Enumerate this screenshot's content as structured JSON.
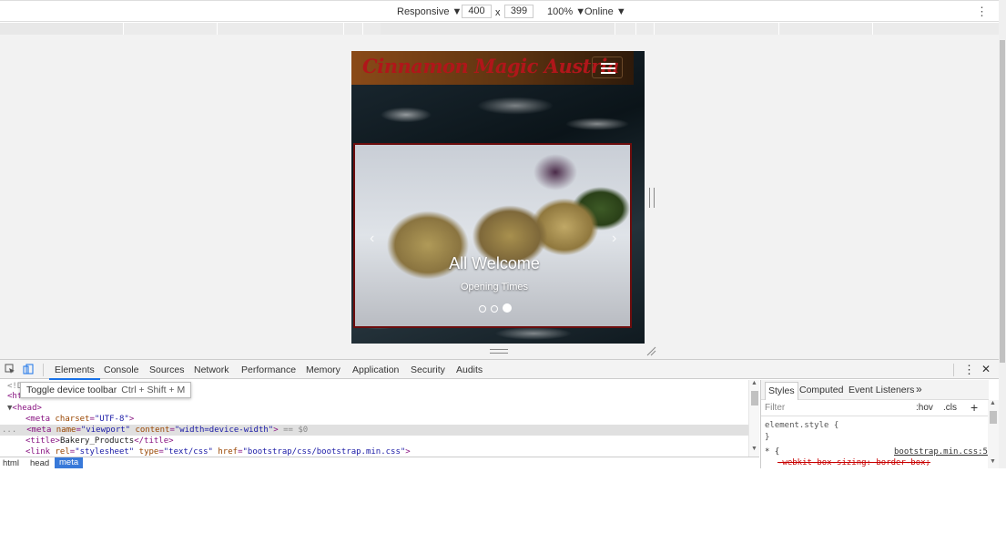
{
  "device_toolbar": {
    "responsive_label": "Responsive ▼",
    "width": "400",
    "times": "x",
    "height": "399",
    "zoom": "100% ▼",
    "network": "Online ▼",
    "more_icon": "kebab-vertical-icon"
  },
  "page": {
    "brand": "Cinnamon Magic Austria",
    "carousel_title": "All Welcome",
    "carousel_subtitle": "Opening Times",
    "prev_arrow": "‹",
    "next_arrow": "›",
    "slide_count": 3,
    "active_slide": 3
  },
  "devtools": {
    "tabs": [
      "Elements",
      "Console",
      "Sources",
      "Network",
      "Performance",
      "Memory",
      "Application",
      "Security",
      "Audits"
    ],
    "active_tab": "Elements",
    "tooltip_text": "Toggle device toolbar",
    "tooltip_shortcut": "Ctrl + Shift + M",
    "close": "✕",
    "more": "⋮",
    "dom_lines": {
      "doctype": "<!D",
      "html_open": "<html>",
      "head_open": "<head>",
      "meta_charset_attr": "charset",
      "meta_charset_val": "\"UTF-8\"",
      "meta_viewport_name_attr": "name",
      "meta_viewport_name_val": "\"viewport\"",
      "meta_viewport_content_attr": "content",
      "meta_viewport_content_val": "\"width=device-width\"",
      "meta_selected_suffix": "== $0",
      "title_text": "Bakery_Products",
      "link_rel_attr": "rel",
      "link_rel_val": "\"stylesheet\"",
      "link_type_attr": "type",
      "link_type_val": "\"text/css\"",
      "link_href_attr": "href",
      "link_href_val": "\"bootstrap/css/bootstrap.min.css\"",
      "gutter_dots": "..."
    },
    "breadcrumbs": [
      "html",
      "head",
      "meta"
    ],
    "styles_tabs": [
      "Styles",
      "Computed",
      "Event Listeners"
    ],
    "styles_more": "»",
    "filter_placeholder": "Filter",
    "hov": ":hov",
    "cls": ".cls",
    "plus": "+",
    "element_style_open": "element.style {",
    "element_style_close": "}",
    "universal_selector": "* {",
    "source_link": "bootstrap.min.css:5",
    "struck_property": "-webkit-box-sizing: border-box;"
  }
}
